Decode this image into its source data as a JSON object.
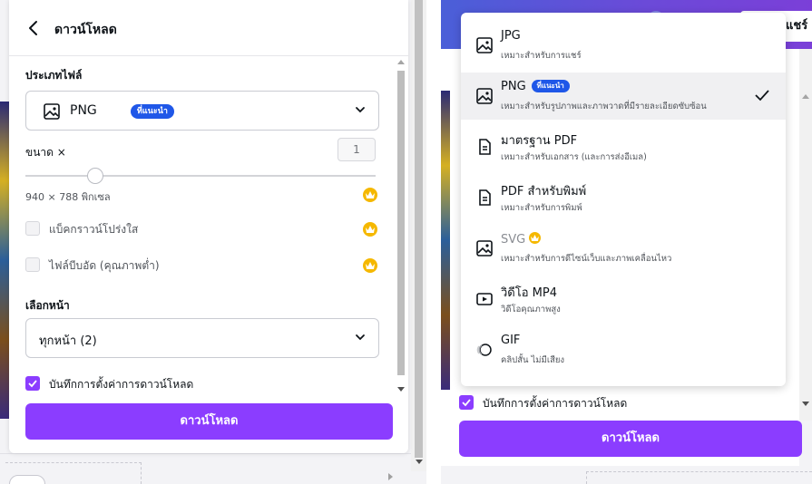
{
  "left": {
    "header_title": "ดาวน์โหลด",
    "file_type_label": "ประเภทไฟล์",
    "file_type": {
      "value": "PNG",
      "badge": "ที่แนะนำ"
    },
    "size_label": "ขนาด ×",
    "size_value": "1",
    "slider_fraction": 0.2,
    "dims_text": "940 × 788 พิกเซล",
    "transparent_bg_label": "แบ็คกราวน์โปร่งใส",
    "compressed_label": "ไฟล์บีบอัด (คุณภาพต่ำ)",
    "select_pages_label": "เลือกหน้า",
    "pages_value": "ทุกหน้า (2)",
    "save_settings_label": "บันทึกการตั้งค่าการดาวน์โหลด",
    "download_button": "ดาวน์โหลด"
  },
  "right": {
    "share_button": "แชร์",
    "save_settings_label": "บันทึกการตั้งค่าการดาวน์โหลด",
    "download_button": "ดาวน์โหลด",
    "options": [
      {
        "name": "JPG",
        "desc": "เหมาะสำหรับการแชร์",
        "icon": "image-icon"
      },
      {
        "name": "PNG",
        "badge": "ที่แนะนำ",
        "desc": "เหมาะสำหรับรูปภาพและภาพวาดที่มีรายละเอียดซับซ้อน",
        "icon": "image-icon",
        "selected": true
      },
      {
        "name": "มาตรฐาน PDF",
        "desc": "เหมาะสำหรับเอกสาร (และการส่งอีเมล)",
        "icon": "document-icon"
      },
      {
        "name": "PDF สำหรับพิมพ์",
        "desc": "เหมาะสำหรับการพิมพ์",
        "icon": "document-icon"
      },
      {
        "name": "SVG",
        "desc": "เหมาะสำหรับการดีไซน์เว็บและภาพเคลื่อนไหว",
        "icon": "image-icon",
        "premium": true
      },
      {
        "name": "วิดีโอ MP4",
        "desc": "วิดีโอคุณภาพสูง",
        "icon": "video-icon"
      },
      {
        "name": "GIF",
        "desc": "คลิปสั้น ไม่มีเสียง",
        "icon": "gif-icon"
      }
    ]
  },
  "colors": {
    "accent": "#8b3dff",
    "badge": "#1f57e8",
    "crown": "#f5b800"
  }
}
